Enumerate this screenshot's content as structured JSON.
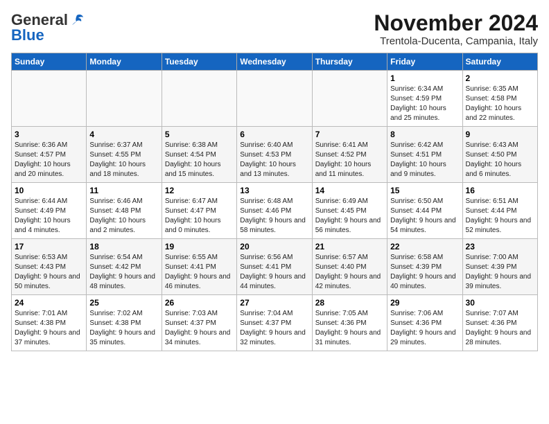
{
  "header": {
    "logo_general": "General",
    "logo_blue": "Blue",
    "month_title": "November 2024",
    "location": "Trentola-Ducenta, Campania, Italy"
  },
  "weekdays": [
    "Sunday",
    "Monday",
    "Tuesday",
    "Wednesday",
    "Thursday",
    "Friday",
    "Saturday"
  ],
  "weeks": [
    [
      {
        "day": "",
        "info": ""
      },
      {
        "day": "",
        "info": ""
      },
      {
        "day": "",
        "info": ""
      },
      {
        "day": "",
        "info": ""
      },
      {
        "day": "",
        "info": ""
      },
      {
        "day": "1",
        "info": "Sunrise: 6:34 AM\nSunset: 4:59 PM\nDaylight: 10 hours and 25 minutes."
      },
      {
        "day": "2",
        "info": "Sunrise: 6:35 AM\nSunset: 4:58 PM\nDaylight: 10 hours and 22 minutes."
      }
    ],
    [
      {
        "day": "3",
        "info": "Sunrise: 6:36 AM\nSunset: 4:57 PM\nDaylight: 10 hours and 20 minutes."
      },
      {
        "day": "4",
        "info": "Sunrise: 6:37 AM\nSunset: 4:55 PM\nDaylight: 10 hours and 18 minutes."
      },
      {
        "day": "5",
        "info": "Sunrise: 6:38 AM\nSunset: 4:54 PM\nDaylight: 10 hours and 15 minutes."
      },
      {
        "day": "6",
        "info": "Sunrise: 6:40 AM\nSunset: 4:53 PM\nDaylight: 10 hours and 13 minutes."
      },
      {
        "day": "7",
        "info": "Sunrise: 6:41 AM\nSunset: 4:52 PM\nDaylight: 10 hours and 11 minutes."
      },
      {
        "day": "8",
        "info": "Sunrise: 6:42 AM\nSunset: 4:51 PM\nDaylight: 10 hours and 9 minutes."
      },
      {
        "day": "9",
        "info": "Sunrise: 6:43 AM\nSunset: 4:50 PM\nDaylight: 10 hours and 6 minutes."
      }
    ],
    [
      {
        "day": "10",
        "info": "Sunrise: 6:44 AM\nSunset: 4:49 PM\nDaylight: 10 hours and 4 minutes."
      },
      {
        "day": "11",
        "info": "Sunrise: 6:46 AM\nSunset: 4:48 PM\nDaylight: 10 hours and 2 minutes."
      },
      {
        "day": "12",
        "info": "Sunrise: 6:47 AM\nSunset: 4:47 PM\nDaylight: 10 hours and 0 minutes."
      },
      {
        "day": "13",
        "info": "Sunrise: 6:48 AM\nSunset: 4:46 PM\nDaylight: 9 hours and 58 minutes."
      },
      {
        "day": "14",
        "info": "Sunrise: 6:49 AM\nSunset: 4:45 PM\nDaylight: 9 hours and 56 minutes."
      },
      {
        "day": "15",
        "info": "Sunrise: 6:50 AM\nSunset: 4:44 PM\nDaylight: 9 hours and 54 minutes."
      },
      {
        "day": "16",
        "info": "Sunrise: 6:51 AM\nSunset: 4:44 PM\nDaylight: 9 hours and 52 minutes."
      }
    ],
    [
      {
        "day": "17",
        "info": "Sunrise: 6:53 AM\nSunset: 4:43 PM\nDaylight: 9 hours and 50 minutes."
      },
      {
        "day": "18",
        "info": "Sunrise: 6:54 AM\nSunset: 4:42 PM\nDaylight: 9 hours and 48 minutes."
      },
      {
        "day": "19",
        "info": "Sunrise: 6:55 AM\nSunset: 4:41 PM\nDaylight: 9 hours and 46 minutes."
      },
      {
        "day": "20",
        "info": "Sunrise: 6:56 AM\nSunset: 4:41 PM\nDaylight: 9 hours and 44 minutes."
      },
      {
        "day": "21",
        "info": "Sunrise: 6:57 AM\nSunset: 4:40 PM\nDaylight: 9 hours and 42 minutes."
      },
      {
        "day": "22",
        "info": "Sunrise: 6:58 AM\nSunset: 4:39 PM\nDaylight: 9 hours and 40 minutes."
      },
      {
        "day": "23",
        "info": "Sunrise: 7:00 AM\nSunset: 4:39 PM\nDaylight: 9 hours and 39 minutes."
      }
    ],
    [
      {
        "day": "24",
        "info": "Sunrise: 7:01 AM\nSunset: 4:38 PM\nDaylight: 9 hours and 37 minutes."
      },
      {
        "day": "25",
        "info": "Sunrise: 7:02 AM\nSunset: 4:38 PM\nDaylight: 9 hours and 35 minutes."
      },
      {
        "day": "26",
        "info": "Sunrise: 7:03 AM\nSunset: 4:37 PM\nDaylight: 9 hours and 34 minutes."
      },
      {
        "day": "27",
        "info": "Sunrise: 7:04 AM\nSunset: 4:37 PM\nDaylight: 9 hours and 32 minutes."
      },
      {
        "day": "28",
        "info": "Sunrise: 7:05 AM\nSunset: 4:36 PM\nDaylight: 9 hours and 31 minutes."
      },
      {
        "day": "29",
        "info": "Sunrise: 7:06 AM\nSunset: 4:36 PM\nDaylight: 9 hours and 29 minutes."
      },
      {
        "day": "30",
        "info": "Sunrise: 7:07 AM\nSunset: 4:36 PM\nDaylight: 9 hours and 28 minutes."
      }
    ]
  ]
}
